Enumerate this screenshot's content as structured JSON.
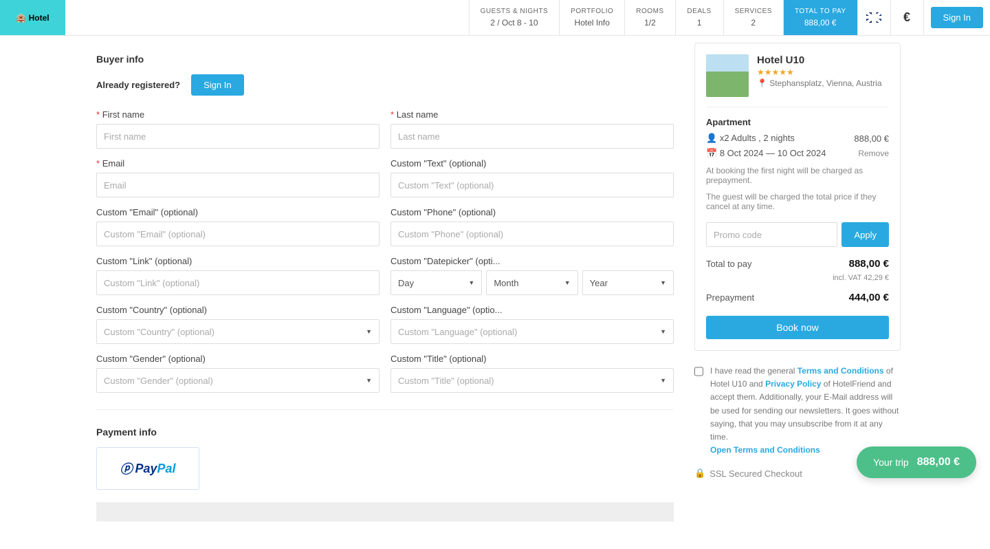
{
  "logo": "🏨 Hotel",
  "nav": {
    "guests": {
      "t": "GUESTS & NIGHTS",
      "b": "2 / Oct 8 - 10"
    },
    "portfolio": {
      "t": "PORTFOLIO",
      "b": "Hotel Info"
    },
    "rooms": {
      "t": "ROOMS",
      "b": "1/2"
    },
    "deals": {
      "t": "DEALS",
      "b": "1"
    },
    "services": {
      "t": "SERVICES",
      "b": "2"
    },
    "total": {
      "t": "TOTAL TO PAY",
      "b": "888,00 €"
    },
    "currency": "€",
    "signin": "Sign In"
  },
  "buyer": {
    "title": "Buyer info",
    "already": "Already registered?",
    "signin": "Sign In",
    "fields": {
      "first": {
        "label": "First name",
        "ph": "First name"
      },
      "last": {
        "label": "Last name",
        "ph": "Last name"
      },
      "email": {
        "label": "Email",
        "ph": "Email"
      },
      "ctext": {
        "label": "Custom \"Text\" (optional)",
        "ph": "Custom \"Text\" (optional)"
      },
      "cemail": {
        "label": "Custom \"Email\" (optional)",
        "ph": "Custom \"Email\" (optional)"
      },
      "cphone": {
        "label": "Custom \"Phone\" (optional)",
        "ph": "Custom \"Phone\" (optional)"
      },
      "clink": {
        "label": "Custom \"Link\" (optional)",
        "ph": "Custom \"Link\" (optional)"
      },
      "cdate": {
        "label": "Custom \"Datepicker\" (opti...",
        "day": "Day",
        "month": "Month",
        "year": "Year"
      },
      "ccountry": {
        "label": "Custom \"Country\" (optional)",
        "ph": "Custom \"Country\" (optional)"
      },
      "clang": {
        "label": "Custom \"Language\" (optio...",
        "ph": "Custom \"Language\" (optional)"
      },
      "cgender": {
        "label": "Custom \"Gender\" (optional)",
        "ph": "Custom \"Gender\" (optional)"
      },
      "ctitle": {
        "label": "Custom \"Title\" (optional)",
        "ph": "Custom \"Title\" (optional)"
      }
    }
  },
  "payment": {
    "title": "Payment info",
    "paypal1": "Pay",
    "paypal2": "Pal"
  },
  "summary": {
    "hotel": "Hotel U10",
    "stars": "★★★★★",
    "addr": "Stephansplatz, Vienna, Austria",
    "roomtype": "Apartment",
    "guests": "x2 Adults , 2 nights",
    "price": "888,00 €",
    "dates": "8 Oct 2024 — 10 Oct 2024",
    "remove": "Remove",
    "note1": "At booking the first night will be charged as prepayment.",
    "note2": "The guest will be charged the total price if they cancel at any time.",
    "promo_ph": "Promo code",
    "apply": "Apply",
    "total_lbl": "Total to pay",
    "total_val": "888,00 €",
    "vat": "incl. VAT 42,29 €",
    "prepay_lbl": "Prepayment",
    "prepay_val": "444,00 €",
    "book": "Book now",
    "terms1": "I have read the general ",
    "terms_tc": "Terms and Conditions",
    "terms2": " of Hotel U10 and ",
    "terms_pp": "Privacy Policy",
    "terms3": " of HotelFriend and accept them. Additionally, your E-Mail address will be used for sending our newsletters. It goes without saying, that you may unsubscribe from it at any time.",
    "open_tc": "Open Terms and Conditions",
    "ssl": "SSL Secured Checkout"
  },
  "fab": {
    "label": "Your trip",
    "amount": "888,00 €"
  }
}
